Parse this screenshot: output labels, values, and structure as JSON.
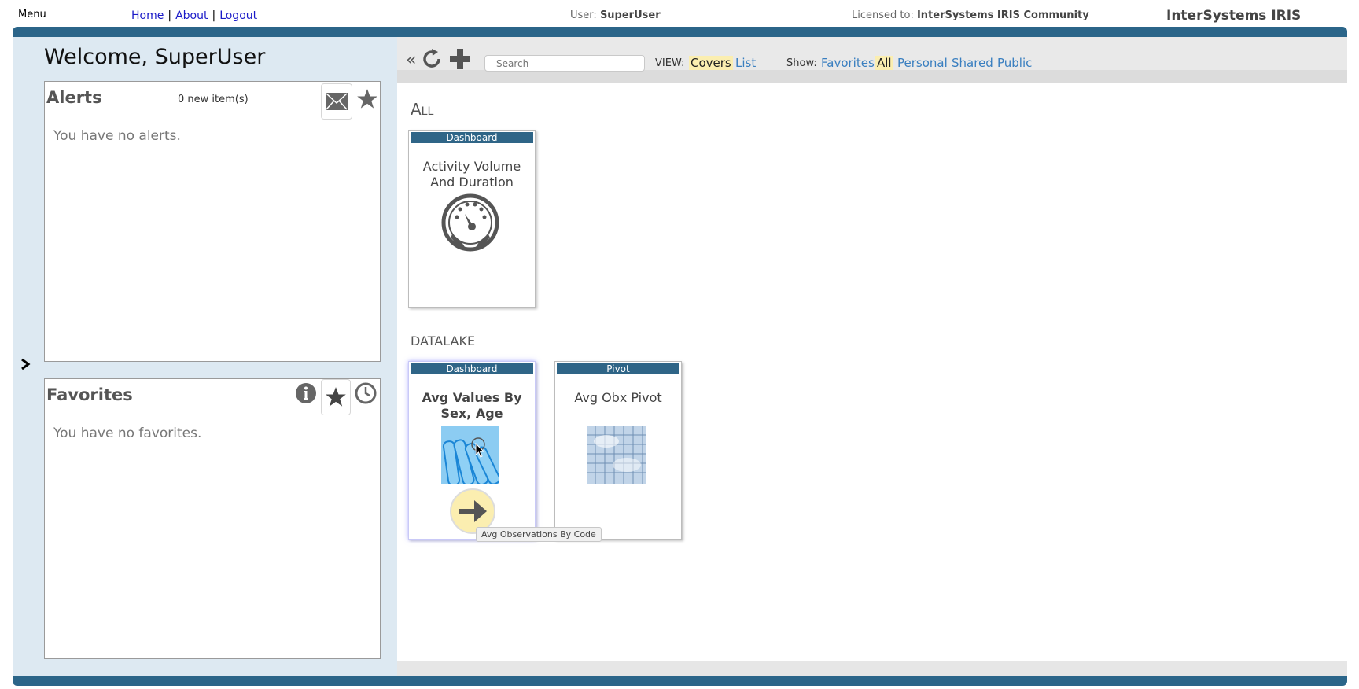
{
  "topbar": {
    "menu_label": "Menu",
    "links": [
      "Home",
      "About",
      "Logout"
    ],
    "user_label": "User:",
    "user_name": "SuperUser",
    "licensed_label": "Licensed to:",
    "licensed_name": "InterSystems IRIS Community",
    "product": "InterSystems IRIS"
  },
  "left": {
    "welcome": "Welcome, SuperUser",
    "alerts": {
      "title": "Alerts",
      "count": "0 new item(s)",
      "message": "You have no alerts.",
      "icons": [
        "envelope-icon",
        "star-icon"
      ]
    },
    "favorites": {
      "title": "Favorites",
      "message": "You have no favorites.",
      "icons": [
        "info-icon",
        "star-icon",
        "clock-icon"
      ]
    }
  },
  "toolbar": {
    "collapse": "«",
    "search_placeholder": "Search",
    "view_label": "VIEW:",
    "view_options": [
      "Covers",
      "List"
    ],
    "view_selected": "Covers",
    "show_label": "Show:",
    "show_options": [
      "Favorites",
      "All",
      "Personal",
      "Shared",
      "Public"
    ],
    "show_selected": "All"
  },
  "sections": [
    {
      "name": "All",
      "items": [
        {
          "type": "Dashboard",
          "title": "Activity Volume And Duration",
          "icon": "gauge-icon"
        }
      ]
    },
    {
      "name": "DATALAKE",
      "items": [
        {
          "type": "Dashboard",
          "title": "Avg Values By Sex, Age",
          "icon": "test-tubes-thumbnail"
        },
        {
          "type": "Pivot",
          "title": "Avg Obx Pivot",
          "icon": "glass-building-thumbnail"
        }
      ]
    }
  ],
  "tooltip": "Avg Observations By Code",
  "colors": {
    "frame": "#2b6589",
    "card_type_bar": "#2f6587",
    "selected_highlight": "#fbeeb0",
    "link": "#3a7fc0"
  }
}
